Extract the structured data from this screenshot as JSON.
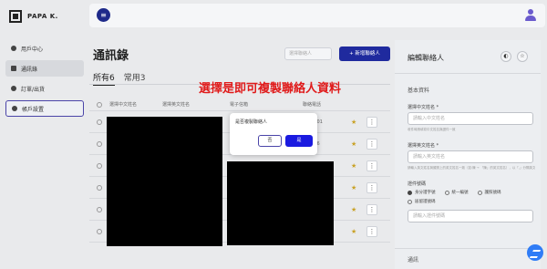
{
  "brand": {
    "name": "PAPA K."
  },
  "topbar": {
    "menu_icon": "menu-icon",
    "user_icon": "user-icon"
  },
  "sidebar": {
    "items": [
      {
        "label": "用戶中心",
        "icon": "user-icon"
      },
      {
        "label": "通訊錄",
        "icon": "address-book-icon"
      },
      {
        "label": "訂單/出貨",
        "icon": "order-icon"
      },
      {
        "label": "帳戶設置",
        "icon": "settings-icon"
      }
    ]
  },
  "main": {
    "title": "通訊錄",
    "filter_placeholder": "選擇聯絡人",
    "add_button": "新增聯絡人",
    "tabs": [
      {
        "label": "所有6"
      },
      {
        "label": "常用3"
      }
    ],
    "promo_text": "選擇是即可複製聯絡人資料",
    "table_headers": [
      "選擇中文姓名",
      "選擇英文姓名",
      "電子信箱",
      "聯絡電話"
    ],
    "rows": [
      {
        "phone": "15801"
      },
      {
        "phone": "6436"
      },
      {
        "phone": ""
      },
      {
        "phone": ""
      },
      {
        "phone": ""
      },
      {
        "phone": ""
      }
    ]
  },
  "dialog": {
    "message": "是否複製聯絡人",
    "no_label": "否",
    "yes_label": "是"
  },
  "right_panel": {
    "title": "編輯聯絡人",
    "section_basic": "基本資料",
    "name_cn_label": "選擇中文姓名 *",
    "name_cn_placeholder": "請輸入中文姓名",
    "name_cn_hint": "收件時請填寫中文姓名與證件一致",
    "name_en_label": "選擇英文姓名 *",
    "name_en_placeholder": "請輸入英文姓名",
    "name_en_hint": "請輸入英文姓名與護照上的英文姓名一致（如:陳 → 「陳」的英文姓名），以「,」分隔英文名",
    "id_label": "證件號碼",
    "id_options": [
      "身分證字號",
      "統一編號",
      "護照號碼",
      "居留證號碼"
    ],
    "id_placeholder": "請輸入證件號碼",
    "section_contact": "通訊"
  },
  "colors": {
    "primary": "#1f2a9e",
    "promo_red": "#e01a1a",
    "dialog_yes": "#1a1ae0",
    "background": "#e9eaec"
  }
}
